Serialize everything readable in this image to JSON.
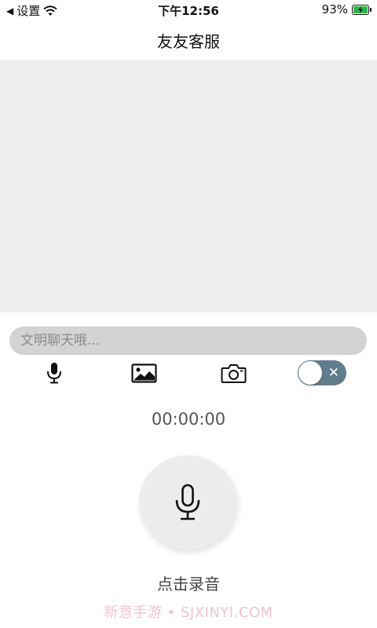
{
  "status_bar": {
    "back_arrow": "◀",
    "back_label": "设置",
    "time": "下午12:56",
    "battery_percent": "93%"
  },
  "nav": {
    "title": "友友客服"
  },
  "input": {
    "placeholder": "文明聊天哦..."
  },
  "toolbar": {
    "items": [
      {
        "icon": "microphone-icon"
      },
      {
        "icon": "image-icon"
      },
      {
        "icon": "camera-icon"
      }
    ],
    "toggle": {
      "icon": "close-icon",
      "glyph": "✕",
      "on": false
    }
  },
  "recorder": {
    "timer": "00:00:00",
    "label": "点击录音"
  },
  "watermark": "新意手游 • SJXINYI.COM",
  "colors": {
    "chat_background": "#efefef",
    "input_background": "#d3d3d3",
    "toggle_track": "#5f7d8c",
    "battery_fill": "#2fb34a"
  }
}
